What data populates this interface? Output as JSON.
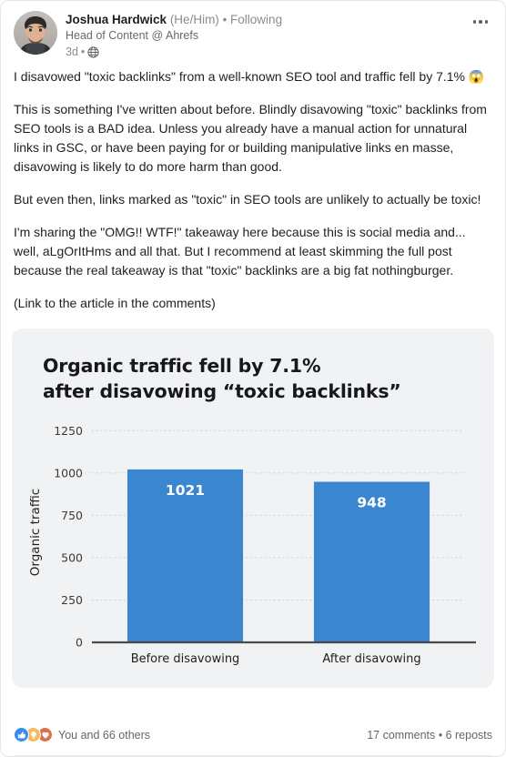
{
  "post": {
    "author": {
      "name": "Joshua Hardwick",
      "pronouns": "(He/Him)",
      "separator": " • ",
      "follow_state": "Following",
      "headline": "Head of Content @ Ahrefs",
      "time_ago": "3d",
      "time_separator": " • ",
      "visibility_icon": "globe-icon",
      "avatar_alt": "Joshua Hardwick profile photo"
    },
    "more_menu_label": "more-options",
    "paragraphs": [
      "I disavowed \"toxic backlinks\" from a well-known SEO tool and traffic fell by 7.1% 😱",
      "This is something I've written about before. Blindly disavowing \"toxic\" backlinks from SEO tools is a BAD idea. Unless you already have a manual action for unnatural links in GSC, or have been paying for or building manipulative links en masse, disavowing is likely to do more harm than good.",
      "But even then, links marked as \"toxic\" in SEO tools are unlikely to actually be toxic!",
      "I'm sharing the \"OMG!! WTF!\" takeaway here because this is social media and... well, aLgOrItHms and all that. But I recommend at least skimming the full post because the real takeaway is that \"toxic\" backlinks are a big fat nothingburger.",
      "(Link to the article in the comments)"
    ],
    "footer": {
      "reaction_icons": [
        "like-icon",
        "insightful-icon",
        "love-icon"
      ],
      "reaction_text": "You and 66 others",
      "comments_text": "17 comments",
      "stats_separator": " • ",
      "reposts_text": "6 reposts"
    }
  },
  "chart_data": {
    "type": "bar",
    "title": "Organic traffic fell by 7.1%\nafter disavowing “toxic backlinks”",
    "categories": [
      "Before disavowing",
      "After disavowing"
    ],
    "values": [
      1021,
      948
    ],
    "data_labels": [
      "1021",
      "948"
    ],
    "xlabel": "",
    "ylabel": "Organic traffic",
    "ylim": [
      0,
      1300
    ],
    "yticks": [
      0,
      250,
      500,
      750,
      1000,
      1250
    ],
    "ytick_labels": [
      "0",
      "250",
      "500",
      "750",
      "1000",
      "1250"
    ],
    "grid": "dotted-horizontal",
    "legend": "none",
    "bar_color": "#3a86d0",
    "background_color": "#f1f2f4",
    "label_color": "#ffffff",
    "axis_color": "#4a4a4a"
  }
}
